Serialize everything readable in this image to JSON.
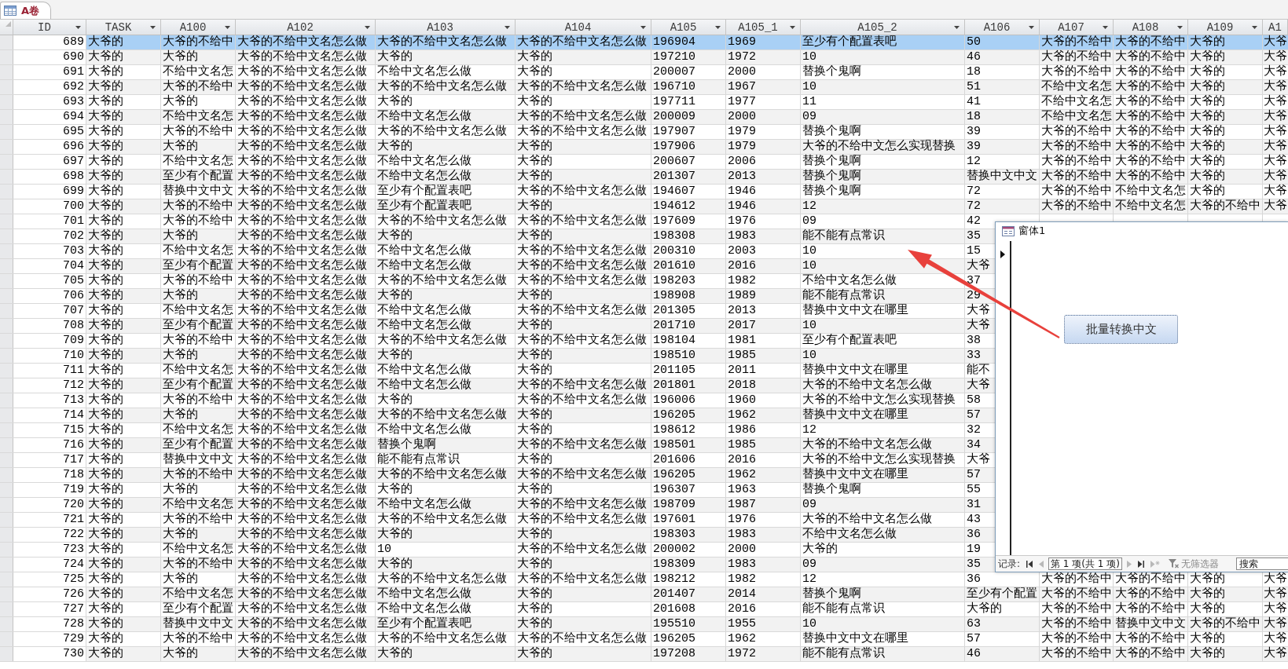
{
  "tabs": [
    {
      "label": "A卷",
      "selected": true
    }
  ],
  "table": {
    "columns": [
      "ID",
      "TASK",
      "A100",
      "A102",
      "A103",
      "A104",
      "A105",
      "A105_1",
      "A105_2",
      "A106",
      "A107",
      "A108",
      "A109",
      "A1"
    ],
    "rows": [
      {
        "selected": true,
        "cells": [
          "689",
          "大爷的",
          "大爷的不给中",
          "大爷的不给中文名怎么做",
          "大爷的不给中文名怎么做",
          "大爷的不给中文名怎么做",
          "196904",
          "1969",
          "至少有个配置表吧",
          "50",
          "大爷的不给中",
          "大爷的不给中",
          "大爷的",
          "大爷"
        ]
      },
      {
        "selected": false,
        "cells": [
          "690",
          "大爷的",
          "大爷的",
          "大爷的不给中文名怎么做",
          "大爷的",
          "大爷的",
          "197210",
          "1972",
          "10",
          "46",
          "大爷的不给中",
          "大爷的不给中",
          "大爷的",
          "大爷"
        ]
      },
      {
        "selected": false,
        "cells": [
          "691",
          "大爷的",
          "不给中文名怎",
          "大爷的不给中文名怎么做",
          "不给中文名怎么做",
          "大爷的",
          "200007",
          "2000",
          "替换个鬼啊",
          "18",
          "大爷的不给中",
          "大爷的不给中",
          "大爷的",
          "大爷"
        ]
      },
      {
        "selected": false,
        "cells": [
          "692",
          "大爷的",
          "大爷的不给中",
          "大爷的不给中文名怎么做",
          "大爷的不给中文名怎么做",
          "大爷的不给中文名怎么做",
          "196710",
          "1967",
          "10",
          "51",
          "不给中文名怎",
          "大爷的不给中",
          "大爷的",
          "大爷"
        ]
      },
      {
        "selected": false,
        "cells": [
          "693",
          "大爷的",
          "大爷的",
          "大爷的不给中文名怎么做",
          "大爷的",
          "大爷的",
          "197711",
          "1977",
          "11",
          "41",
          "不给中文名怎",
          "大爷的不给中",
          "大爷的",
          "大爷"
        ]
      },
      {
        "selected": false,
        "cells": [
          "694",
          "大爷的",
          "不给中文名怎",
          "大爷的不给中文名怎么做",
          "不给中文名怎么做",
          "大爷的不给中文名怎么做",
          "200009",
          "2000",
          "09",
          "18",
          "不给中文名怎",
          "大爷的不给中",
          "大爷的",
          "大爷"
        ]
      },
      {
        "selected": false,
        "cells": [
          "695",
          "大爷的",
          "大爷的不给中",
          "大爷的不给中文名怎么做",
          "大爷的不给中文名怎么做",
          "大爷的不给中文名怎么做",
          "197907",
          "1979",
          "替换个鬼啊",
          "39",
          "大爷的不给中",
          "大爷的不给中",
          "大爷的",
          "大爷"
        ]
      },
      {
        "selected": false,
        "cells": [
          "696",
          "大爷的",
          "大爷的",
          "大爷的不给中文名怎么做",
          "大爷的",
          "大爷的",
          "197906",
          "1979",
          "大爷的不给中文怎么实现替换",
          "39",
          "大爷的不给中",
          "大爷的不给中",
          "大爷的",
          "大爷"
        ]
      },
      {
        "selected": false,
        "cells": [
          "697",
          "大爷的",
          "不给中文名怎",
          "大爷的不给中文名怎么做",
          "不给中文名怎么做",
          "大爷的",
          "200607",
          "2006",
          "替换个鬼啊",
          "12",
          "大爷的不给中",
          "大爷的不给中",
          "大爷的",
          "大爷"
        ]
      },
      {
        "selected": false,
        "cells": [
          "698",
          "大爷的",
          "至少有个配置",
          "大爷的不给中文名怎么做",
          "不给中文名怎么做",
          "大爷的",
          "201307",
          "2013",
          "替换个鬼啊",
          "替换中文中文",
          "大爷的不给中",
          "大爷的不给中",
          "大爷的",
          "大爷"
        ]
      },
      {
        "selected": false,
        "cells": [
          "699",
          "大爷的",
          "替换中文中文",
          "大爷的不给中文名怎么做",
          "至少有个配置表吧",
          "大爷的不给中文名怎么做",
          "194607",
          "1946",
          "替换个鬼啊",
          "72",
          "大爷的不给中",
          "不给中文名怎",
          "大爷的",
          "大爷"
        ]
      },
      {
        "selected": false,
        "cells": [
          "700",
          "大爷的",
          "大爷的不给中",
          "大爷的不给中文名怎么做",
          "至少有个配置表吧",
          "大爷的",
          "194612",
          "1946",
          "12",
          "72",
          "大爷的不给中",
          "不给中文名怎",
          "大爷的不给中",
          "大爷"
        ]
      },
      {
        "selected": false,
        "cells": [
          "701",
          "大爷的",
          "大爷的不给中",
          "大爷的不给中文名怎么做",
          "大爷的不给中文名怎么做",
          "大爷的不给中文名怎么做",
          "197609",
          "1976",
          "09",
          "42"
        ]
      },
      {
        "selected": false,
        "cells": [
          "702",
          "大爷的",
          "大爷的",
          "大爷的不给中文名怎么做",
          "大爷的",
          "大爷的",
          "198308",
          "1983",
          "能不能有点常识",
          "35"
        ]
      },
      {
        "selected": false,
        "cells": [
          "703",
          "大爷的",
          "不给中文名怎",
          "大爷的不给中文名怎么做",
          "不给中文名怎么做",
          "大爷的不给中文名怎么做",
          "200310",
          "2003",
          "10",
          "15"
        ]
      },
      {
        "selected": false,
        "cells": [
          "704",
          "大爷的",
          "至少有个配置",
          "大爷的不给中文名怎么做",
          "不给中文名怎么做",
          "大爷的不给中文名怎么做",
          "201610",
          "2016",
          "10",
          "大爷"
        ]
      },
      {
        "selected": false,
        "cells": [
          "705",
          "大爷的",
          "大爷的不给中",
          "大爷的不给中文名怎么做",
          "大爷的不给中文名怎么做",
          "大爷的不给中文名怎么做",
          "198203",
          "1982",
          "不给中文名怎么做",
          "37"
        ]
      },
      {
        "selected": false,
        "cells": [
          "706",
          "大爷的",
          "大爷的",
          "大爷的不给中文名怎么做",
          "大爷的",
          "大爷的",
          "198908",
          "1989",
          "能不能有点常识",
          "29"
        ]
      },
      {
        "selected": false,
        "cells": [
          "707",
          "大爷的",
          "不给中文名怎",
          "大爷的不给中文名怎么做",
          "不给中文名怎么做",
          "大爷的不给中文名怎么做",
          "201305",
          "2013",
          "替换中文中文在哪里",
          "大爷"
        ]
      },
      {
        "selected": false,
        "cells": [
          "708",
          "大爷的",
          "至少有个配置",
          "大爷的不给中文名怎么做",
          "不给中文名怎么做",
          "大爷的",
          "201710",
          "2017",
          "10",
          "大爷"
        ]
      },
      {
        "selected": false,
        "cells": [
          "709",
          "大爷的",
          "大爷的不给中",
          "大爷的不给中文名怎么做",
          "大爷的不给中文名怎么做",
          "大爷的不给中文名怎么做",
          "198104",
          "1981",
          "至少有个配置表吧",
          "38"
        ]
      },
      {
        "selected": false,
        "cells": [
          "710",
          "大爷的",
          "大爷的",
          "大爷的不给中文名怎么做",
          "大爷的",
          "大爷的",
          "198510",
          "1985",
          "10",
          "33"
        ]
      },
      {
        "selected": false,
        "cells": [
          "711",
          "大爷的",
          "不给中文名怎",
          "大爷的不给中文名怎么做",
          "不给中文名怎么做",
          "大爷的",
          "201105",
          "2011",
          "替换中文中文在哪里",
          "能不"
        ]
      },
      {
        "selected": false,
        "cells": [
          "712",
          "大爷的",
          "至少有个配置",
          "大爷的不给中文名怎么做",
          "不给中文名怎么做",
          "大爷的不给中文名怎么做",
          "201801",
          "2018",
          "大爷的不给中文名怎么做",
          "大爷"
        ]
      },
      {
        "selected": false,
        "cells": [
          "713",
          "大爷的",
          "大爷的不给中",
          "大爷的不给中文名怎么做",
          "大爷的",
          "大爷的不给中文名怎么做",
          "196006",
          "1960",
          "大爷的不给中文怎么实现替换",
          "58"
        ]
      },
      {
        "selected": false,
        "cells": [
          "714",
          "大爷的",
          "大爷的",
          "大爷的不给中文名怎么做",
          "大爷的不给中文名怎么做",
          "大爷的",
          "196205",
          "1962",
          "替换中文中文在哪里",
          "57"
        ]
      },
      {
        "selected": false,
        "cells": [
          "715",
          "大爷的",
          "不给中文名怎",
          "大爷的不给中文名怎么做",
          "不给中文名怎么做",
          "大爷的",
          "198612",
          "1986",
          "12",
          "32"
        ]
      },
      {
        "selected": false,
        "cells": [
          "716",
          "大爷的",
          "至少有个配置",
          "大爷的不给中文名怎么做",
          "替换个鬼啊",
          "大爷的不给中文名怎么做",
          "198501",
          "1985",
          "大爷的不给中文名怎么做",
          "34"
        ]
      },
      {
        "selected": false,
        "cells": [
          "717",
          "大爷的",
          "替换中文中文",
          "大爷的不给中文名怎么做",
          "能不能有点常识",
          "大爷的",
          "201606",
          "2016",
          "大爷的不给中文怎么实现替换",
          "大爷"
        ]
      },
      {
        "selected": false,
        "cells": [
          "718",
          "大爷的",
          "大爷的不给中",
          "大爷的不给中文名怎么做",
          "大爷的不给中文名怎么做",
          "大爷的不给中文名怎么做",
          "196205",
          "1962",
          "替换中文中文在哪里",
          "57"
        ]
      },
      {
        "selected": false,
        "cells": [
          "719",
          "大爷的",
          "大爷的",
          "大爷的不给中文名怎么做",
          "大爷的",
          "大爷的",
          "196307",
          "1963",
          "替换个鬼啊",
          "55"
        ]
      },
      {
        "selected": false,
        "cells": [
          "720",
          "大爷的",
          "不给中文名怎",
          "大爷的不给中文名怎么做",
          "不给中文名怎么做",
          "大爷的不给中文名怎么做",
          "198709",
          "1987",
          "09",
          "31"
        ]
      },
      {
        "selected": false,
        "cells": [
          "721",
          "大爷的",
          "大爷的不给中",
          "大爷的不给中文名怎么做",
          "大爷的不给中文名怎么做",
          "大爷的不给中文名怎么做",
          "197601",
          "1976",
          "大爷的不给中文名怎么做",
          "43"
        ]
      },
      {
        "selected": false,
        "cells": [
          "722",
          "大爷的",
          "大爷的",
          "大爷的不给中文名怎么做",
          "大爷的",
          "大爷的",
          "198303",
          "1983",
          "不给中文名怎么做",
          "36"
        ]
      },
      {
        "selected": false,
        "cells": [
          "723",
          "大爷的",
          "不给中文名怎",
          "大爷的不给中文名怎么做",
          "10",
          "大爷的不给中文名怎么做",
          "200002",
          "2000",
          "大爷的",
          "19"
        ]
      },
      {
        "selected": false,
        "cells": [
          "724",
          "大爷的",
          "大爷的不给中",
          "大爷的不给中文名怎么做",
          "大爷的",
          "大爷的",
          "198309",
          "1983",
          "09",
          "35"
        ]
      },
      {
        "selected": false,
        "cells": [
          "725",
          "大爷的",
          "大爷的",
          "大爷的不给中文名怎么做",
          "大爷的不给中文名怎么做",
          "大爷的不给中文名怎么做",
          "198212",
          "1982",
          "12",
          "36",
          "大爷的不给中",
          "大爷的不给中",
          "大爷的",
          "大爷"
        ]
      },
      {
        "selected": false,
        "cells": [
          "726",
          "大爷的",
          "不给中文名怎",
          "大爷的不给中文名怎么做",
          "不给中文名怎么做",
          "大爷的",
          "201407",
          "2014",
          "替换个鬼啊",
          "至少有个配置",
          "大爷的不给中",
          "大爷的不给中",
          "大爷的",
          "大爷"
        ]
      },
      {
        "selected": false,
        "cells": [
          "727",
          "大爷的",
          "至少有个配置",
          "大爷的不给中文名怎么做",
          "不给中文名怎么做",
          "大爷的",
          "201608",
          "2016",
          "能不能有点常识",
          "大爷的",
          "大爷的不给中",
          "大爷的不给中",
          "大爷的",
          "大爷"
        ]
      },
      {
        "selected": false,
        "cells": [
          "728",
          "大爷的",
          "替换中文中文",
          "大爷的不给中文名怎么做",
          "至少有个配置表吧",
          "大爷的",
          "195510",
          "1955",
          "10",
          "63",
          "大爷的不给中",
          "替换中文中文",
          "大爷的不给中",
          "大爷"
        ]
      },
      {
        "selected": false,
        "cells": [
          "729",
          "大爷的",
          "大爷的不给中",
          "大爷的不给中文名怎么做",
          "大爷的不给中文名怎么做",
          "大爷的不给中文名怎么做",
          "196205",
          "1962",
          "替换中文中文在哪里",
          "57",
          "大爷的不给中",
          "大爷的不给中",
          "大爷的",
          "大爷"
        ]
      },
      {
        "selected": false,
        "cells": [
          "730",
          "大爷的",
          "大爷的",
          "大爷的不给中文名怎么做",
          "大爷的",
          "大爷的",
          "197208",
          "1972",
          "能不能有点常识",
          "46",
          "大爷的不给中",
          "大爷的不给中",
          "大爷的",
          "大爷"
        ]
      }
    ]
  },
  "form_window": {
    "title": "窗体1",
    "button": "批量转换中文",
    "navigation": {
      "label": "记录:",
      "controls": [
        {
          "kind": "first",
          "disabled": false
        },
        {
          "kind": "previous",
          "disabled": true
        },
        {
          "kind": "record",
          "value": "第 1 项(共 1 项)"
        },
        {
          "kind": "next",
          "disabled": true
        },
        {
          "kind": "last",
          "disabled": false
        },
        {
          "kind": "new",
          "disabled": true
        },
        {
          "kind": "filter",
          "label": "无筛选器",
          "disabled": true
        },
        {
          "kind": "search",
          "placeholder": "搜索"
        }
      ]
    }
  }
}
